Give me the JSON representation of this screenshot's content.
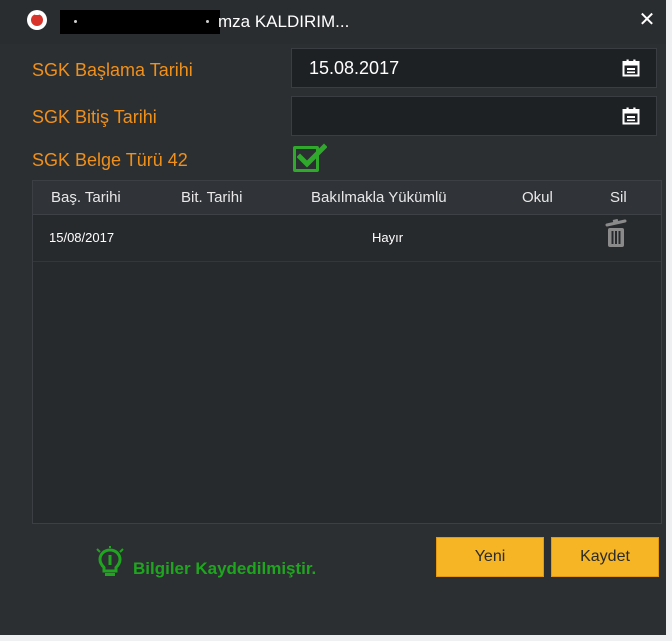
{
  "window": {
    "title": "mza KALDIRIM...",
    "close_glyph": "✕"
  },
  "form": {
    "start_label": "SGK Başlama Tarihi",
    "start_value": "15.08.2017",
    "end_label": "SGK Bitiş Tarihi",
    "end_value": "",
    "doc_type_label": "SGK Belge Türü 42",
    "doc_type_checked": true
  },
  "table": {
    "columns": [
      "Baş. Tarihi",
      "Bit. Tarihi",
      "Bakılmakla Yükümlü",
      "Okul",
      "Sil"
    ],
    "rows": [
      {
        "start": "15/08/2017",
        "end": "",
        "dependent": "Hayır",
        "school": "",
        "delete_icon": "trash-icon"
      }
    ]
  },
  "status": {
    "icon": "lightbulb-icon",
    "message": "Bilgiler Kaydedilmiştir."
  },
  "buttons": {
    "new_label": "Yeni",
    "save_label": "Kaydet"
  },
  "colors": {
    "accent_orange": "#f0901a",
    "success_green": "#1fa51f",
    "button_yellow": "#f5b524",
    "background": "#2c2f32"
  }
}
